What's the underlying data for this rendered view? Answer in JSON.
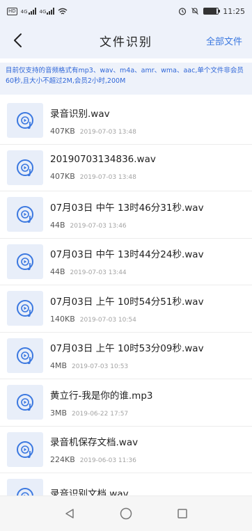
{
  "status_bar": {
    "net_badge": "HD",
    "sig1": "4G",
    "sig2": "4G",
    "time": "11:25",
    "battery_level": 0.9,
    "icons": [
      "wifi-icon",
      "alarm-icon",
      "mute-icon",
      "battery-icon"
    ]
  },
  "header": {
    "title": "文件识别",
    "action_label": "全部文件",
    "back_icon": "chevron-left-icon"
  },
  "notice": {
    "text": "目前仅支持的音频格式有mp3、wav、m4a、amr、wma、aac,单个文件非会员60秒,且大小不超过2M,会员2小时,200M"
  },
  "files": [
    {
      "name": "录音识别.wav",
      "size": "407KB",
      "date": "2019-07-03 13:48"
    },
    {
      "name": "20190703134836.wav",
      "size": "407KB",
      "date": "2019-07-03 13:48"
    },
    {
      "name": "07月03日 中午 13时46分31秒.wav",
      "size": "44B",
      "date": "2019-07-03 13:46"
    },
    {
      "name": "07月03日 中午 13时44分24秒.wav",
      "size": "44B",
      "date": "2019-07-03 13:44"
    },
    {
      "name": "07月03日 上午 10时54分51秒.wav",
      "size": "140KB",
      "date": "2019-07-03 10:54"
    },
    {
      "name": "07月03日 上午 10时53分09秒.wav",
      "size": "4MB",
      "date": "2019-07-03 10:53"
    },
    {
      "name": "黄立行-我是你的谁.mp3",
      "size": "3MB",
      "date": "2019-06-22 17:57"
    },
    {
      "name": "录音机保存文档.wav",
      "size": "224KB",
      "date": "2019-06-03 11:36"
    },
    {
      "name": "录音识别文档.wav",
      "size": "",
      "date": ""
    }
  ],
  "colors": {
    "accent": "#3b78e0",
    "notice_text": "#2f66d8",
    "header_bg": "#eef2fa"
  },
  "nav": {
    "icons": [
      "back-triangle-icon",
      "home-circle-icon",
      "recents-square-icon"
    ]
  }
}
